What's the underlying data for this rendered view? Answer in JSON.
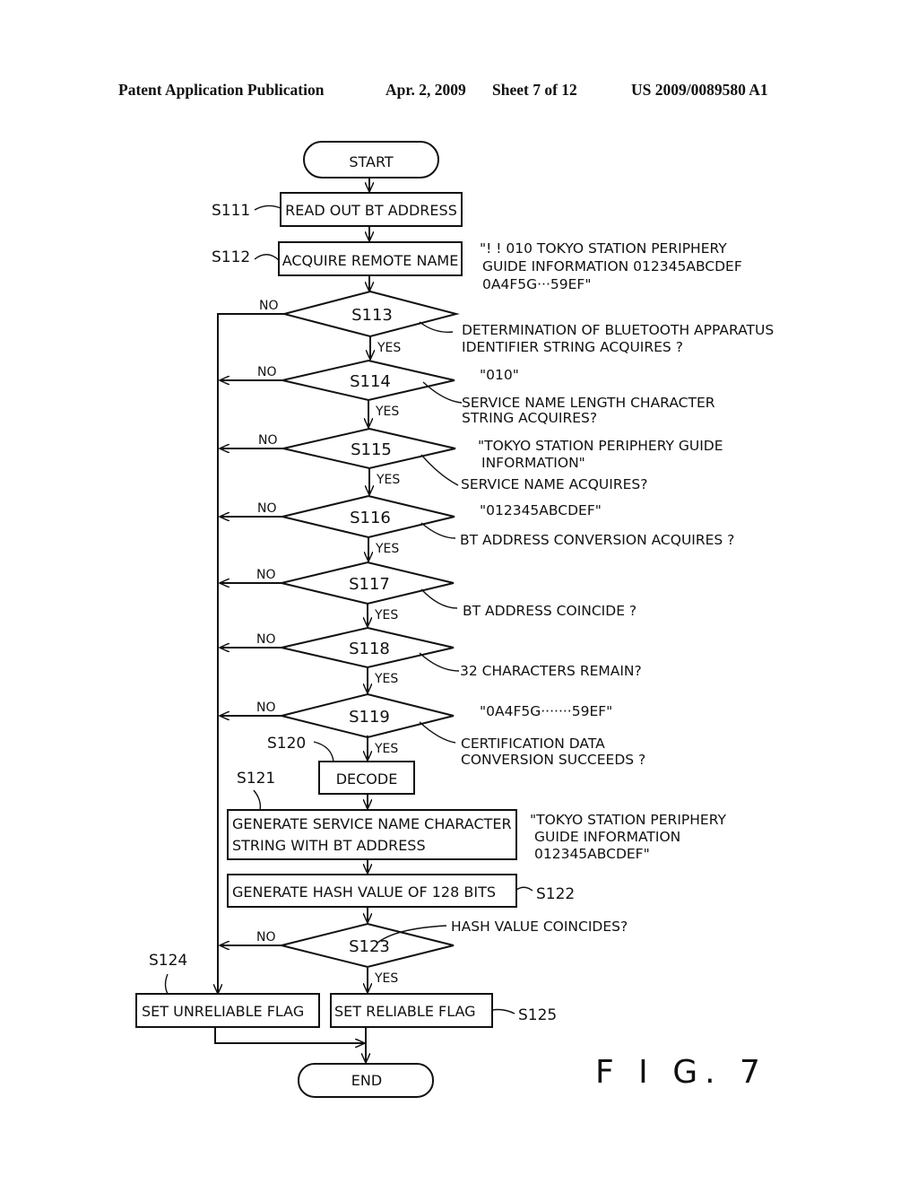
{
  "header": {
    "publication": "Patent Application Publication",
    "date": "Apr. 2, 2009",
    "sheet": "Sheet 7 of 12",
    "patent_number": "US 2009/0089580 A1"
  },
  "figure_label": "F I G. 7",
  "terminals": {
    "start": "START",
    "end": "END"
  },
  "steps": {
    "s111": {
      "id": "S111",
      "text": "READ OUT BT ADDRESS"
    },
    "s112": {
      "id": "S112",
      "text": "ACQUIRE REMOTE NAME"
    },
    "s113": {
      "id": "S113"
    },
    "s114": {
      "id": "S114"
    },
    "s115": {
      "id": "S115"
    },
    "s116": {
      "id": "S116"
    },
    "s117": {
      "id": "S117"
    },
    "s118": {
      "id": "S118"
    },
    "s119": {
      "id": "S119"
    },
    "s120": {
      "id": "S120",
      "text": "DECODE"
    },
    "s121": {
      "id": "S121",
      "line1": "GENERATE SERVICE NAME CHARACTER",
      "line2": "STRING WITH BT ADDRESS"
    },
    "s122": {
      "id": "S122",
      "text": "GENERATE HASH VALUE OF 128 BITS"
    },
    "s123": {
      "id": "S123"
    },
    "s124": {
      "id": "S124",
      "text": "SET UNRELIABLE FLAG"
    },
    "s125": {
      "id": "S125",
      "text": "SET RELIABLE FLAG"
    }
  },
  "branch_labels": {
    "yes": "YES",
    "no": "NO"
  },
  "annotations": {
    "remote_name": [
      "\"! ! 010 TOKYO STATION PERIPHERY",
      "GUIDE INFORMATION 012345ABCDEF",
      "0A4F5G···59EF\""
    ],
    "s113": [
      "DETERMINATION OF BLUETOOTH APPARATUS",
      "IDENTIFIER STRING ACQUIRES ?"
    ],
    "s114_value": "\"010\"",
    "s114": [
      "SERVICE NAME LENGTH CHARACTER",
      "STRING ACQUIRES?"
    ],
    "s115_value": [
      "\"TOKYO STATION PERIPHERY GUIDE",
      "INFORMATION\""
    ],
    "s115": "SERVICE NAME ACQUIRES?",
    "s116_value": "\"012345ABCDEF\"",
    "s116": "BT ADDRESS CONVERSION ACQUIRES ?",
    "s117": "BT ADDRESS COINCIDE ?",
    "s118": "32 CHARACTERS REMAIN?",
    "s119_value": "\"0A4F5G·······59EF\"",
    "s119": [
      "CERTIFICATION DATA",
      "CONVERSION SUCCEEDS ?"
    ],
    "s121_value": [
      "\"TOKYO STATION PERIPHERY",
      "GUIDE INFORMATION",
      "012345ABCDEF\""
    ],
    "s123": "HASH VALUE COINCIDES?"
  }
}
